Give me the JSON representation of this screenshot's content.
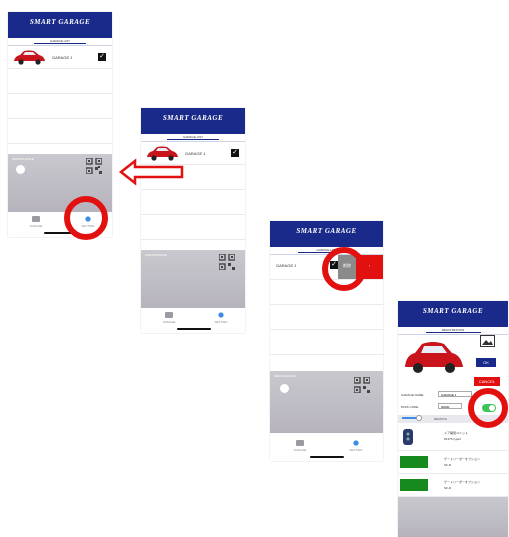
{
  "header": {
    "logo": "SMART GARAGE"
  },
  "screens": {
    "list": {
      "subtitle": "GARAGE LIST",
      "garage_name": "GARAGE 1",
      "check_mark": "✓",
      "maintenance_label": "MAINTENANCE",
      "tabs": [
        {
          "label": "GARAGE",
          "icon": "garage-icon"
        },
        {
          "label": "SETTING",
          "icon": "setting-icon"
        }
      ]
    },
    "swipe": {
      "delete_label": "削除",
      "more_mark": "›"
    },
    "registration": {
      "subtitle": "REGISTRATION",
      "ok_label": "OK",
      "cancel_label": "CANCEL",
      "field_garage_name": "GARAGE NAME",
      "value_garage_name": "GARAGE 1",
      "field_pass_code": "PASS CODE",
      "value_pass_code": "00000",
      "section_label": "REMOTE",
      "devices": [
        {
          "line1": "ドア開閉ユニット",
          "line2": "8137S type3"
        },
        {
          "line1": "ゲートリーダーオプション",
          "line2": "SF-R"
        },
        {
          "line1": "ゲートリーダーオプション",
          "line2": "SF-R"
        }
      ]
    }
  },
  "icons": {
    "back_arrow": "left-arrow-icon",
    "photo": "image-icon",
    "qr": "qr-code-icon",
    "toggle": "toggle-switch"
  },
  "colors": {
    "brand_blue": "#1a2a8a",
    "highlight_red": "#e31010",
    "delete_grey": "#8a8a8a",
    "toggle_green": "#3cc35a",
    "device_green": "#178a1e"
  }
}
